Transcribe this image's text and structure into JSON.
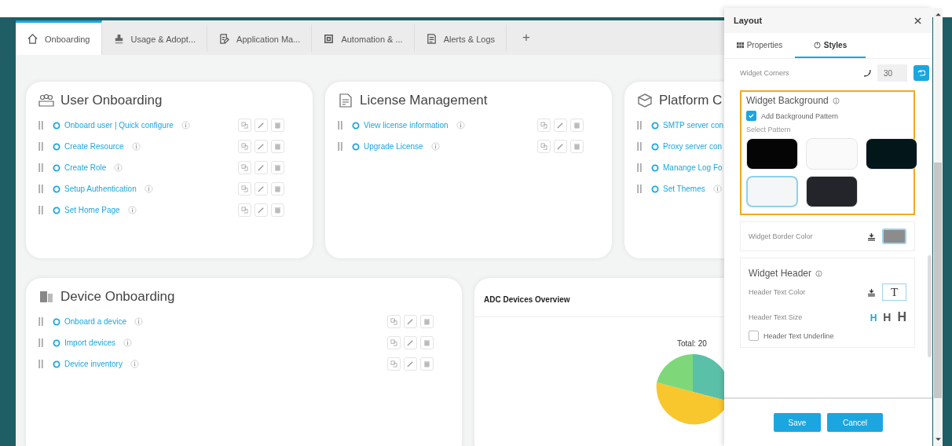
{
  "tabs": [
    {
      "label": "Onboarding",
      "selected": true
    },
    {
      "label": "Usage & Adopt...",
      "selected": false
    },
    {
      "label": "Application Ma...",
      "selected": false
    },
    {
      "label": "Automation & ...",
      "selected": false
    },
    {
      "label": "Alerts & Logs",
      "selected": false
    }
  ],
  "add_tab": "+",
  "widgets": [
    {
      "kind": "links",
      "title": "User Onboarding",
      "actions": true,
      "items": [
        "Onboard user | Quick configure",
        "Create Resource",
        "Create Role",
        "Setup Authentication",
        "Set Home Page"
      ]
    },
    {
      "kind": "links",
      "title": "License Management",
      "actions": true,
      "items": [
        "View license information",
        "Upgrade License"
      ]
    },
    {
      "kind": "links",
      "title": "Platform C",
      "actions": false,
      "items": [
        "SMTP server con",
        "Proxy server con",
        "Manange Log Fo",
        "Set Themes"
      ]
    },
    {
      "kind": "links",
      "title": "Device Onboarding",
      "actions": true,
      "items": [
        "Onboard a device",
        "Import devices",
        "Device inventory"
      ]
    },
    {
      "kind": "chart",
      "title": "ADC Devices Overview",
      "total": "Total: 20"
    }
  ],
  "panel": {
    "title": "Layout",
    "tabs": [
      {
        "label": "Properties",
        "selected": false
      },
      {
        "label": "Styles",
        "selected": true
      }
    ],
    "corners": {
      "label": "Widget Corners",
      "value": "30"
    },
    "background": {
      "title": "Widget Background",
      "highlighted": true,
      "checkbox": {
        "label": "Add Background Pattern",
        "checked": true
      },
      "select_label": "Select Pattern",
      "patterns": [
        {
          "color": "#050505",
          "selected": false
        },
        {
          "color": "#fafafa",
          "selected": false
        },
        {
          "color": "#03161a",
          "selected": false
        },
        {
          "color": "#f4f6f7",
          "selected": true
        },
        {
          "color": "#23252b",
          "selected": false
        }
      ]
    },
    "border_color": {
      "label": "Widget Border Color",
      "color": "#8c8c8c"
    },
    "header": {
      "title": "Widget Header",
      "text_color_label": "Header Text Color",
      "text_sample": "T",
      "text_size_label": "Header Text Size",
      "sizes": [
        {
          "label": "H",
          "selected": true
        },
        {
          "label": "H",
          "selected": false
        },
        {
          "label": "H",
          "selected": false
        }
      ],
      "underline": {
        "label": "Header Text Underline",
        "checked": false
      }
    },
    "buttons": [
      "Save",
      "Cancel"
    ]
  }
}
